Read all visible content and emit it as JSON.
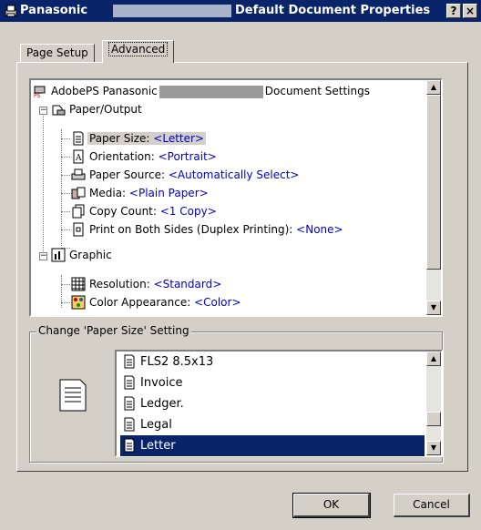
{
  "window": {
    "app_name": "Panasonic",
    "title": "Default Document Properties",
    "help_label": "?",
    "close_label": "×"
  },
  "tabs": [
    {
      "label": "Page Setup"
    },
    {
      "label": "Advanced"
    }
  ],
  "tree": {
    "root_prefix": "AdobePS Panasonic",
    "root_suffix": "Document Settings",
    "groups": [
      {
        "label": "Paper/Output",
        "items": [
          {
            "name": "Paper Size: ",
            "value": "<Letter>"
          },
          {
            "name": "Orientation: ",
            "value": "<Portrait>"
          },
          {
            "name": "Paper Source: ",
            "value": "<Automatically Select>"
          },
          {
            "name": "Media: ",
            "value": "<Plain Paper>"
          },
          {
            "name": "Copy Count: ",
            "value": "<1 Copy>"
          },
          {
            "name": "Print on Both Sides (Duplex Printing): ",
            "value": "<None>"
          }
        ]
      },
      {
        "label": "Graphic",
        "items": [
          {
            "name": "Resolution: ",
            "value": "<Standard>"
          },
          {
            "name": "Color Appearance: ",
            "value": "<Color>"
          }
        ]
      }
    ]
  },
  "change_setting": {
    "label": "Change 'Paper Size' Setting",
    "options": [
      "FLS2 8.5x13",
      "Invoice",
      "Ledger.",
      "Legal",
      "Letter"
    ],
    "selected": "Letter"
  },
  "buttons": {
    "ok": "OK",
    "cancel": "Cancel"
  },
  "colors": {
    "title_bar": "#0a246a",
    "value_text": "#0000cc",
    "selection": "#0a246a"
  },
  "icons": {
    "window": "printer-icon",
    "document": "document-icon",
    "graphic": "bar-chart-icon"
  }
}
